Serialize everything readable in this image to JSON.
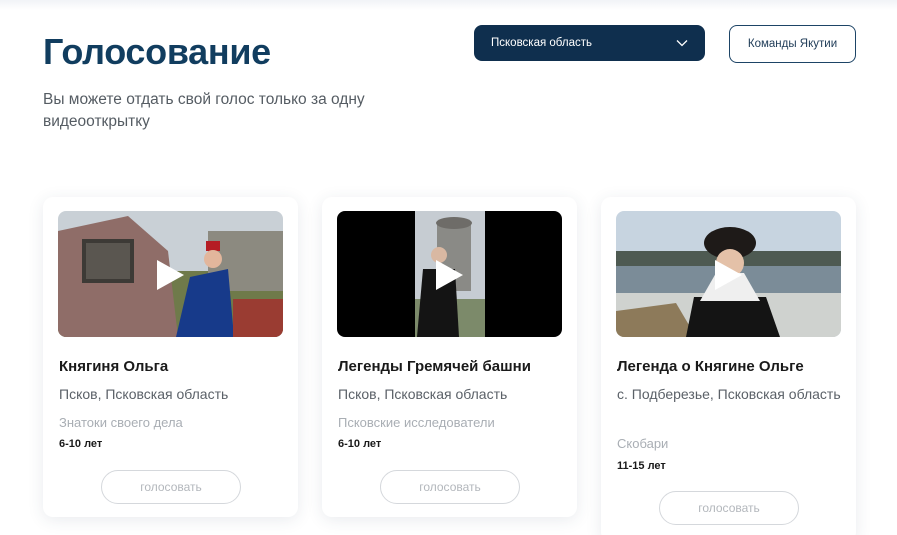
{
  "header": {
    "title": "Голосование",
    "subtitle": "Вы можете отдать свой голос только за одну видеооткрытку"
  },
  "filters": {
    "region_selected": "Псковская область",
    "team_button_label": "Команды Якутии"
  },
  "cards": [
    {
      "title": "Княгиня Ольга",
      "location": "Псков, Псковская область",
      "team": "Знатоки своего дела",
      "age": "6-10 лет",
      "vote_label": "голосовать"
    },
    {
      "title": "Легенды Гремячей башни",
      "location": "Псков, Псковская область",
      "team": "Псковские исследователи",
      "age": "6-10 лет",
      "vote_label": "голосовать"
    },
    {
      "title": "Легенда о Княгине Ольге",
      "location": "с. Подберезье, Псковская область",
      "team": "Скобари",
      "age": "11-15 лет",
      "vote_label": "голосовать"
    }
  ],
  "icons": {
    "dropdown": "chevron-down-icon",
    "video": "play-icon"
  },
  "colors": {
    "title": "#113d5f",
    "select_bg": "#0f2f4e",
    "button_border": "#1d4466"
  }
}
